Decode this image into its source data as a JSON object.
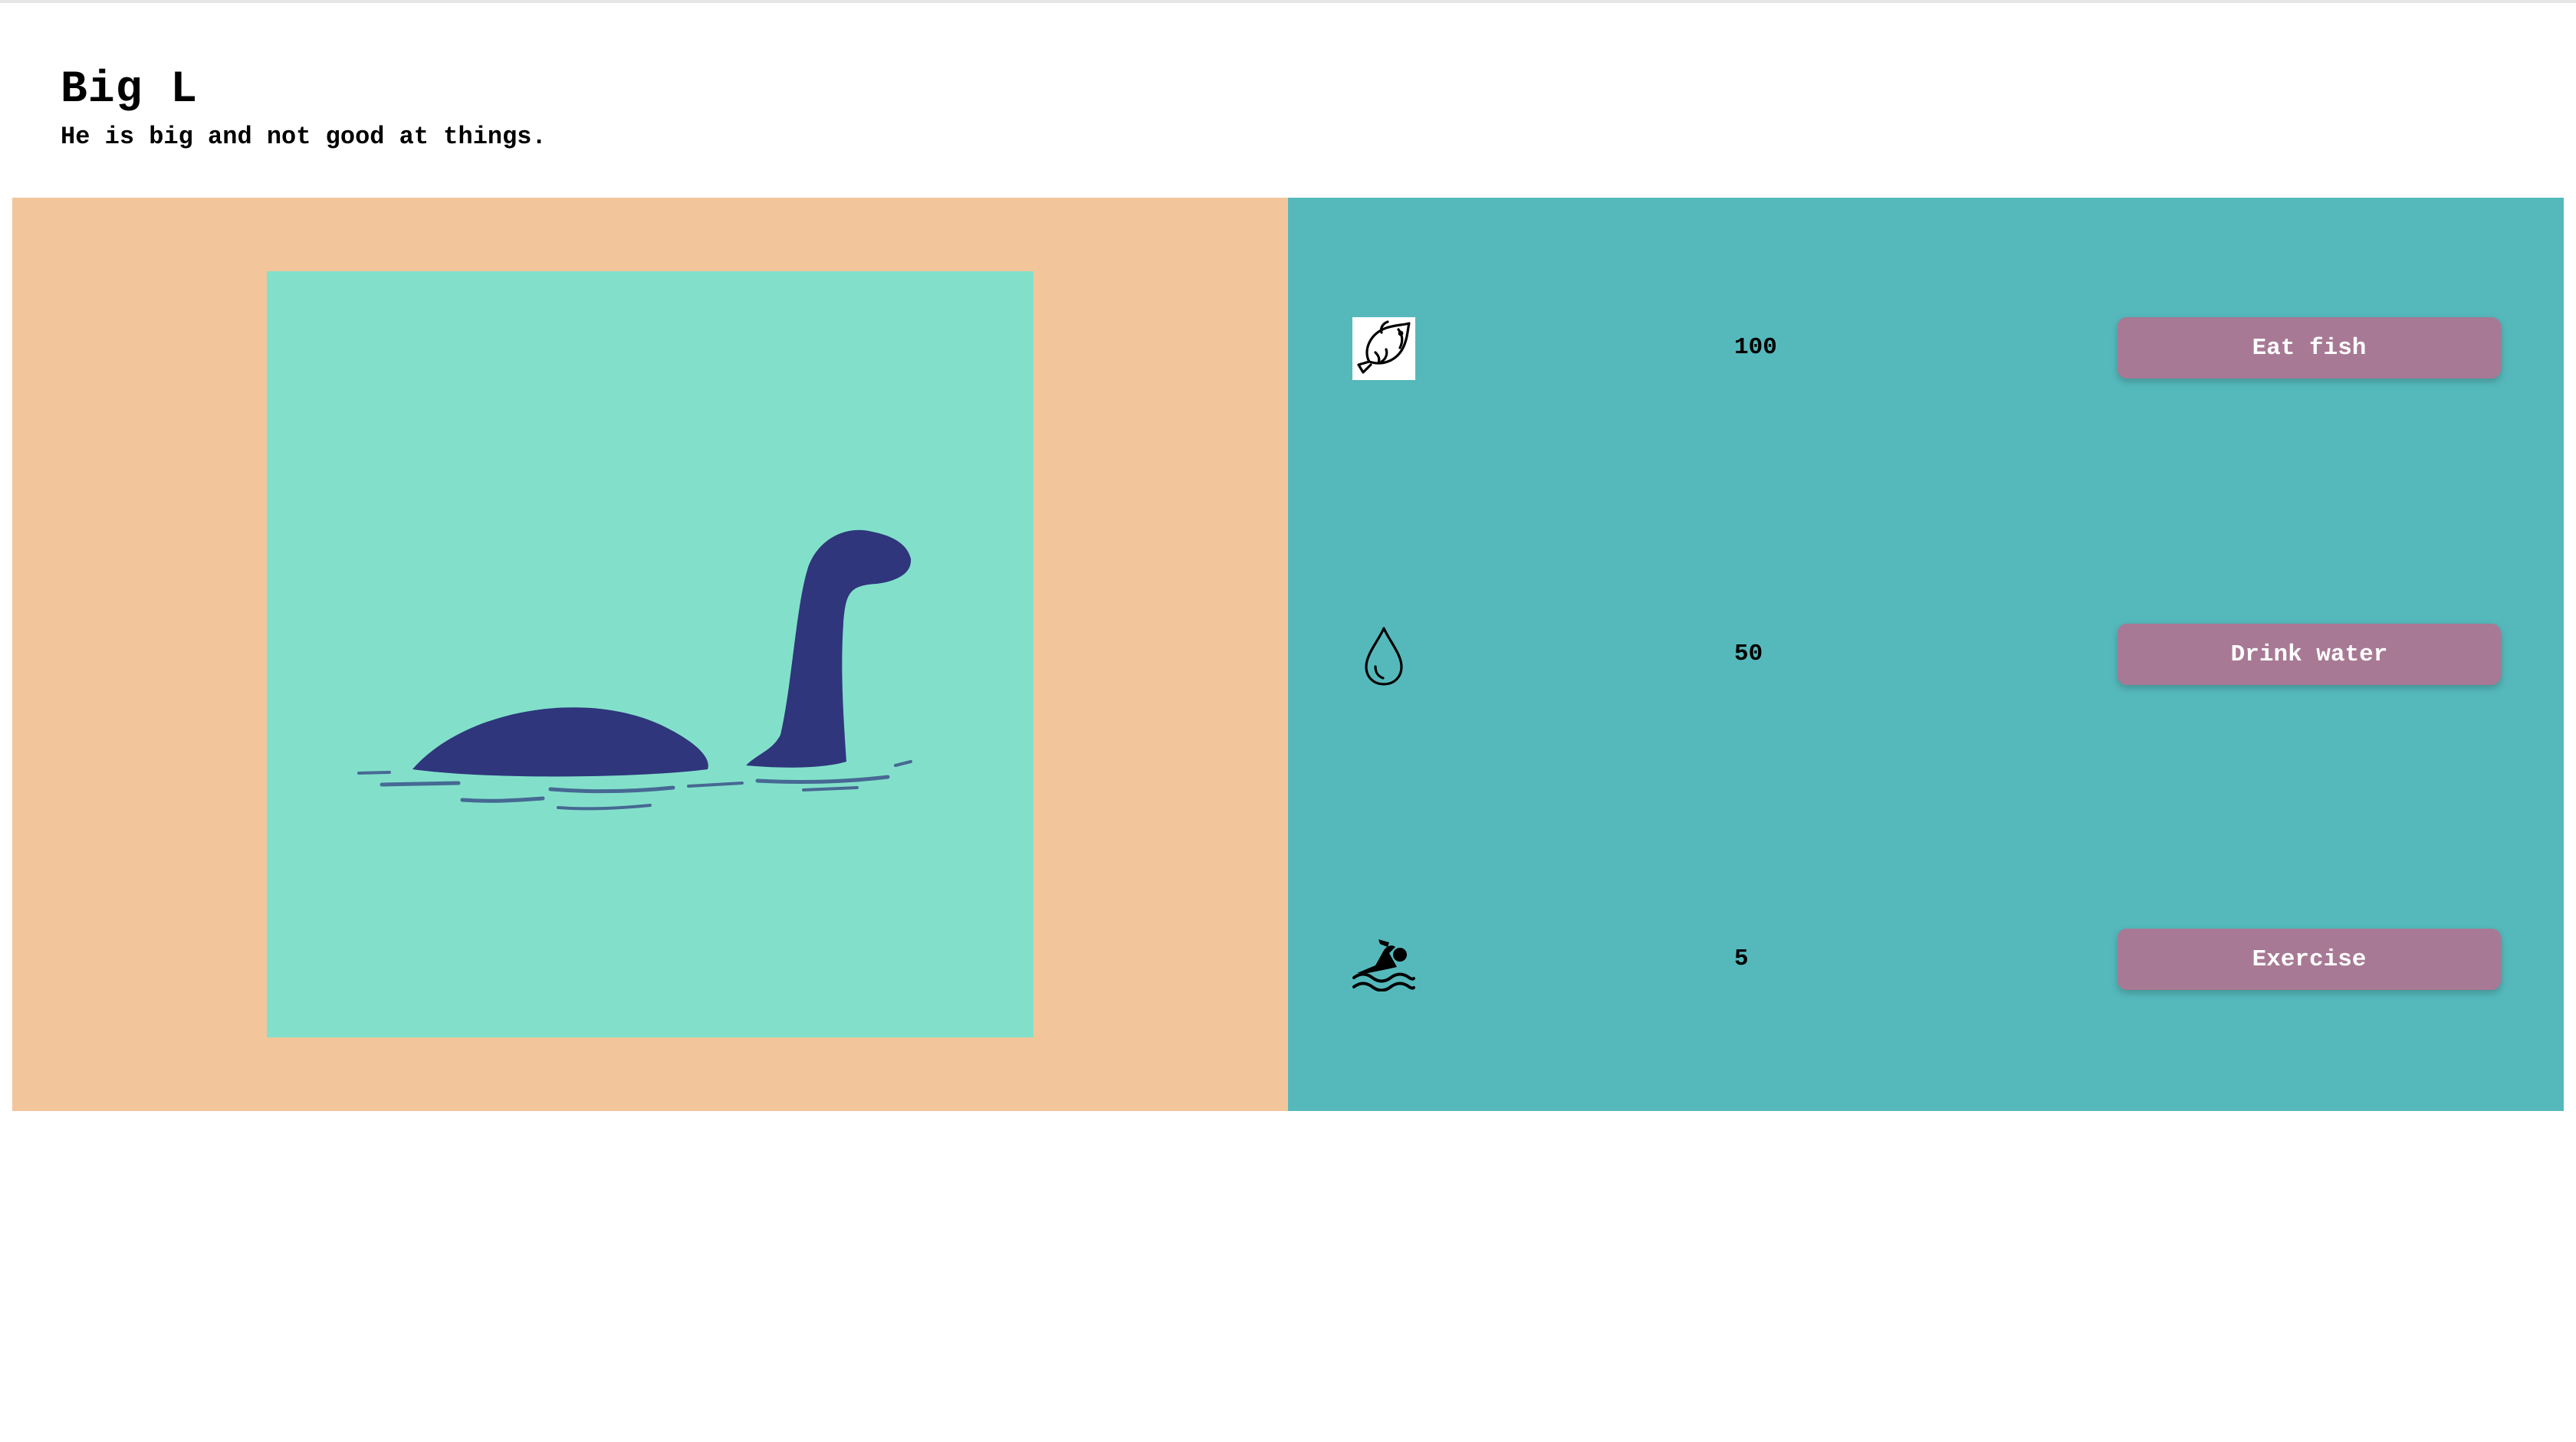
{
  "colors": {
    "left_panel_bg": "#f3c59b",
    "pet_bg": "#82e0ca",
    "pet_silhouette": "#2f367c",
    "right_panel_bg": "#55b9bc",
    "button_bg": "#a87994",
    "button_text": "#ffffff"
  },
  "header": {
    "title": "Big L",
    "subtitle": "He is big and not good at things."
  },
  "pet": {
    "image_icon": "loch-ness-monster-icon"
  },
  "stats": [
    {
      "icon": "fish-icon",
      "value": "100",
      "button_label": "Eat fish"
    },
    {
      "icon": "water-drop-icon",
      "value": "50",
      "button_label": "Drink water"
    },
    {
      "icon": "swimmer-icon",
      "value": "5",
      "button_label": "Exercise"
    }
  ]
}
